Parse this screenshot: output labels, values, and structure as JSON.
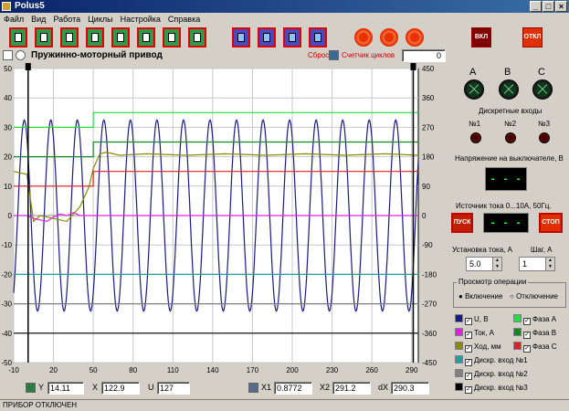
{
  "window": {
    "title": "Polus5"
  },
  "menu": [
    "Файл",
    "Вид",
    "Работа",
    "Циклы",
    "Настройка",
    "Справка"
  ],
  "toolbar": {
    "on_label": "ВКЛ",
    "off_label": "ОТКЛ"
  },
  "header": {
    "title": "Пружинно-моторный привод",
    "reset_label": "Сброс",
    "cycle_counter_label": "Счетчик циклов",
    "cycle_counter_value": "0"
  },
  "chart_data": {
    "type": "line",
    "xlim": [
      -10,
      295
    ],
    "ylim": [
      -50,
      50
    ],
    "y2lim": [
      -450,
      450
    ],
    "x_ticks": [
      "-10",
      "20",
      "50",
      "80",
      "110",
      "140",
      "170",
      "200",
      "230",
      "260",
      "290"
    ],
    "y_ticks": [
      "50",
      "40",
      "30",
      "20",
      "10",
      "0",
      "-10",
      "-20",
      "-30",
      "-40",
      "-50"
    ],
    "y2_ticks": [
      "450",
      "360",
      "270",
      "180",
      "90",
      "0",
      "-90",
      "-180",
      "-270",
      "-360",
      "-450"
    ],
    "cursor_x1": 0.8772,
    "cursor_x2": 291.2,
    "series": [
      {
        "name": "U, B",
        "color": "#1a1a8a",
        "kind": "sine",
        "amplitude": 32.5,
        "period": 20,
        "phase_x": -7
      },
      {
        "name": "Ход, мм",
        "color": "#8a8a00",
        "kind": "path",
        "x": [
          -10,
          0,
          5,
          10,
          20,
          30,
          40,
          47,
          50,
          55,
          60,
          70,
          90,
          120,
          150,
          180,
          210,
          240,
          270,
          295
        ],
        "y": [
          15,
          14,
          -2,
          0,
          -1,
          -2,
          3,
          10,
          16,
          21,
          21.5,
          20.5,
          21,
          20.5,
          21,
          20.5,
          21,
          20.5,
          21,
          20.5
        ]
      },
      {
        "name": "Ток, А",
        "color": "#e020e0",
        "kind": "path",
        "x": [
          -10,
          0,
          5,
          10,
          15,
          20,
          25,
          30,
          35,
          40,
          295
        ],
        "y": [
          0,
          0,
          -1,
          -1.5,
          -2,
          -0.5,
          0.5,
          0,
          1,
          0,
          0
        ]
      },
      {
        "name": "Фаза А",
        "color": "#20e040",
        "kind": "step",
        "x": [
          -10,
          50,
          50,
          295
        ],
        "y": [
          30,
          30,
          35,
          35
        ]
      },
      {
        "name": "Фаза В",
        "color": "#108a20",
        "kind": "step",
        "x": [
          -10,
          50,
          50,
          295
        ],
        "y": [
          20,
          20,
          25,
          25
        ]
      },
      {
        "name": "Фаза С",
        "color": "#e02020",
        "kind": "step",
        "x": [
          -10,
          50,
          50,
          295
        ],
        "y": [
          10,
          10,
          15,
          15
        ]
      },
      {
        "name": "Дискр. вход №1",
        "color": "#20a0a0",
        "kind": "step",
        "x": [
          -10,
          295
        ],
        "y": [
          -20,
          -20
        ]
      },
      {
        "name": "Дискр. вход №2",
        "color": "#808080",
        "kind": "step",
        "x": [
          -10,
          295
        ],
        "y": [
          -30,
          -30
        ]
      },
      {
        "name": "Дискр. вход №3",
        "color": "#000000",
        "kind": "step",
        "x": [
          -10,
          295
        ],
        "y": [
          -40,
          -40
        ]
      }
    ]
  },
  "status_row": {
    "y_label": "Y",
    "y_value": "14.11",
    "x_label": "X",
    "x_value": "122.9",
    "u_label": "U",
    "u_value": "127",
    "x1_label": "X1",
    "x1_value": "0.8772",
    "x2_label": "X2",
    "x2_value": "291.2",
    "dx_label": "dX",
    "dx_value": "290.3"
  },
  "right_panel": {
    "phase_labels": [
      "A",
      "B",
      "C"
    ],
    "discrete_title": "Дискретные входы",
    "discrete_labels": [
      "№1",
      "№2",
      "№3"
    ],
    "voltage_title": "Напряжение на выключателе, В",
    "voltage_display": "- - -",
    "source_title": "Источник тока 0...10А, 50Гц.",
    "start_label": "ПУСК",
    "stop_label": "СТОП",
    "current_display": "- - -",
    "set_current_label": "Установка тока, А",
    "step_label": "Шаг, А",
    "set_current_value": "5.0",
    "step_value": "1",
    "view_title": "Просмотр операции",
    "view_on": "Включение",
    "view_off": "Отключение",
    "view_selected": "Включение"
  },
  "legend": [
    {
      "label": "U, B",
      "color": "#1a1a8a"
    },
    {
      "label": "Фаза А",
      "color": "#20e040"
    },
    {
      "label": "Ток, А",
      "color": "#e020e0"
    },
    {
      "label": "Фаза В",
      "color": "#108a20"
    },
    {
      "label": "Ход, мм",
      "color": "#8a8a00"
    },
    {
      "label": "Фаза С",
      "color": "#e02020"
    },
    {
      "label": "Дискр. вход №1",
      "color": "#20a0a0"
    },
    {
      "label": "Дискр. вход №2",
      "color": "#808080"
    },
    {
      "label": "Дискр. вход №3",
      "color": "#000000"
    }
  ],
  "statusbar": {
    "text": "ПРИБОР ОТКЛЮЧЕН"
  }
}
